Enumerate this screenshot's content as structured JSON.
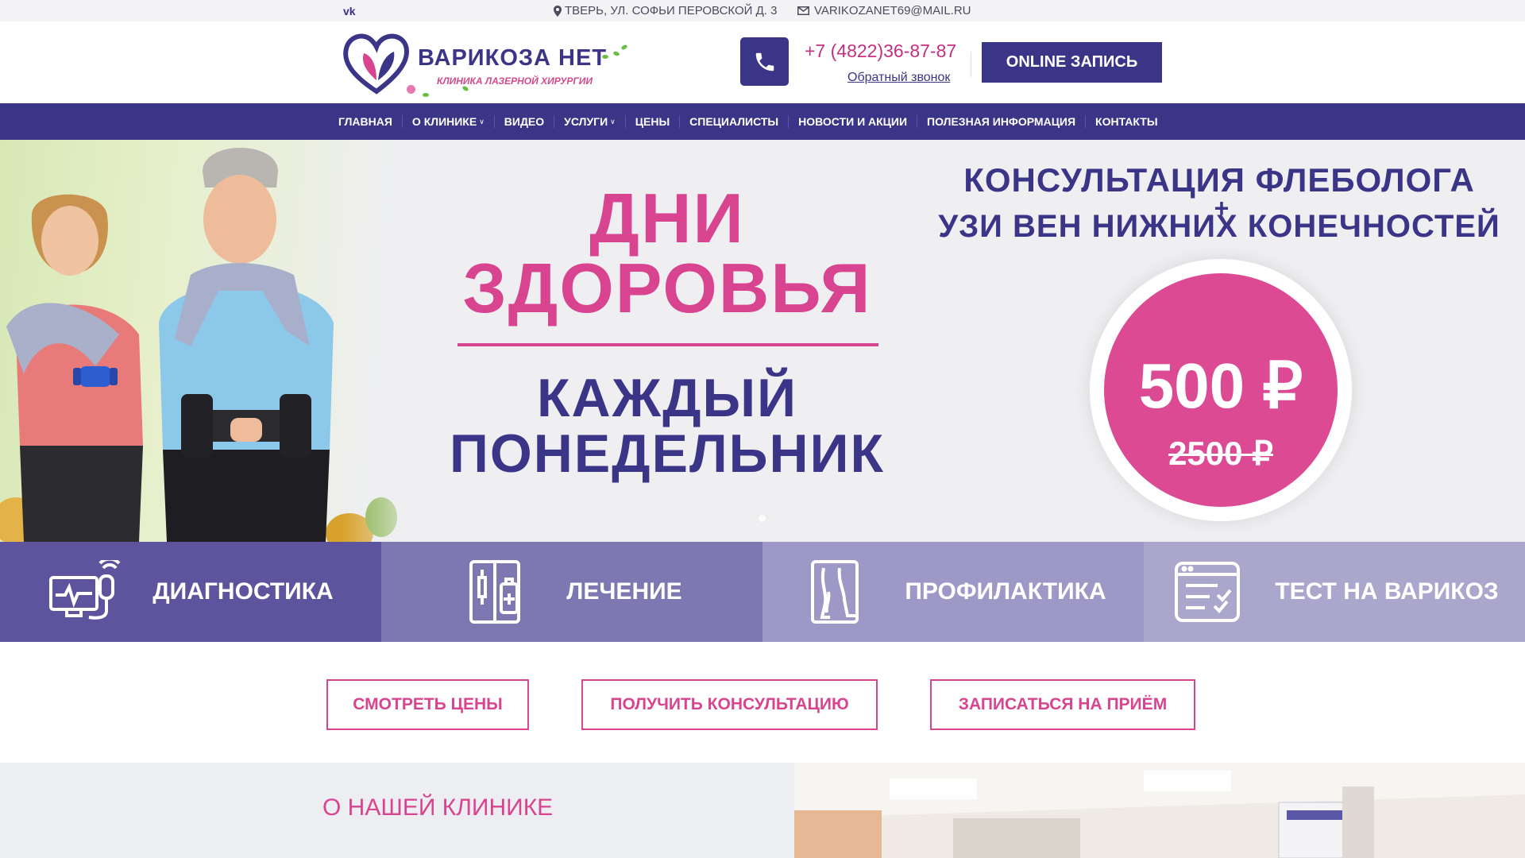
{
  "topbar": {
    "vk_label": "vk",
    "address": "ТВЕРЬ, УЛ. СОФЬИ ПЕРОВСКОЙ Д. 3",
    "email": "VARIKOZANET69@MAIL.RU"
  },
  "header": {
    "logo_name": "ВАРИКОЗА НЕТ",
    "logo_subtitle": "КЛИНИКА ЛАЗЕРНОЙ ХИРУРГИИ",
    "phone_code": "+7 (4822)",
    "phone_number": "36-87-87",
    "callback_label": "Обратный звонок",
    "online_button": "ONLINE ЗАПИСЬ"
  },
  "nav": {
    "items": [
      {
        "label": "ГЛАВНАЯ",
        "dropdown": false
      },
      {
        "label": "О КЛИНИКЕ",
        "dropdown": true
      },
      {
        "label": "ВИДЕО",
        "dropdown": false
      },
      {
        "label": "УСЛУГИ",
        "dropdown": true
      },
      {
        "label": "ЦЕНЫ",
        "dropdown": false
      },
      {
        "label": "СПЕЦИАЛИСТЫ",
        "dropdown": false
      },
      {
        "label": "НОВОСТИ И АКЦИИ",
        "dropdown": false
      },
      {
        "label": "ПОЛЕЗНАЯ ИНФОРМАЦИЯ",
        "dropdown": false
      },
      {
        "label": "КОНТАКТЫ",
        "dropdown": false
      }
    ]
  },
  "hero": {
    "headline_line1": "ДНИ",
    "headline_line2": "ЗДОРОВЬЯ",
    "sub_line1": "КАЖДЫЙ",
    "sub_line2": "ПОНЕДЕЛЬНИК",
    "right_line1": "КОНСУЛЬТАЦИЯ ФЛЕБОЛОГА",
    "right_plus": "+",
    "right_line2": "УЗИ ВЕН НИЖНИХ КОНЕЧНОСТЕЙ",
    "price_new": "500 ₽",
    "price_old": "2500 ₽"
  },
  "tiles": [
    {
      "label": "ДИАГНОСТИКА",
      "icon": "ultrasound-monitor-icon",
      "color": "#5e549e"
    },
    {
      "label": "ЛЕЧЕНИЕ",
      "icon": "medicine-cabinet-icon",
      "color": "#7d77b2"
    },
    {
      "label": "ПРОФИЛАКТИКА",
      "icon": "legs-icon",
      "color": "#9d98c5"
    },
    {
      "label": "ТЕСТ НА ВАРИКОЗ",
      "icon": "checklist-icon",
      "color": "#aaa6cc"
    }
  ],
  "cta": {
    "prices": "СМОТРЕТЬ ЦЕНЫ",
    "consult": "ПОЛУЧИТЬ КОНСУЛЬТАЦИЮ",
    "appointment": "ЗАПИСАТЬСЯ НА ПРИЁМ"
  },
  "about": {
    "title": "О НАШЕЙ КЛИНИКЕ"
  },
  "colors": {
    "brand_purple": "#3b3588",
    "brand_pink": "#d8448f"
  }
}
